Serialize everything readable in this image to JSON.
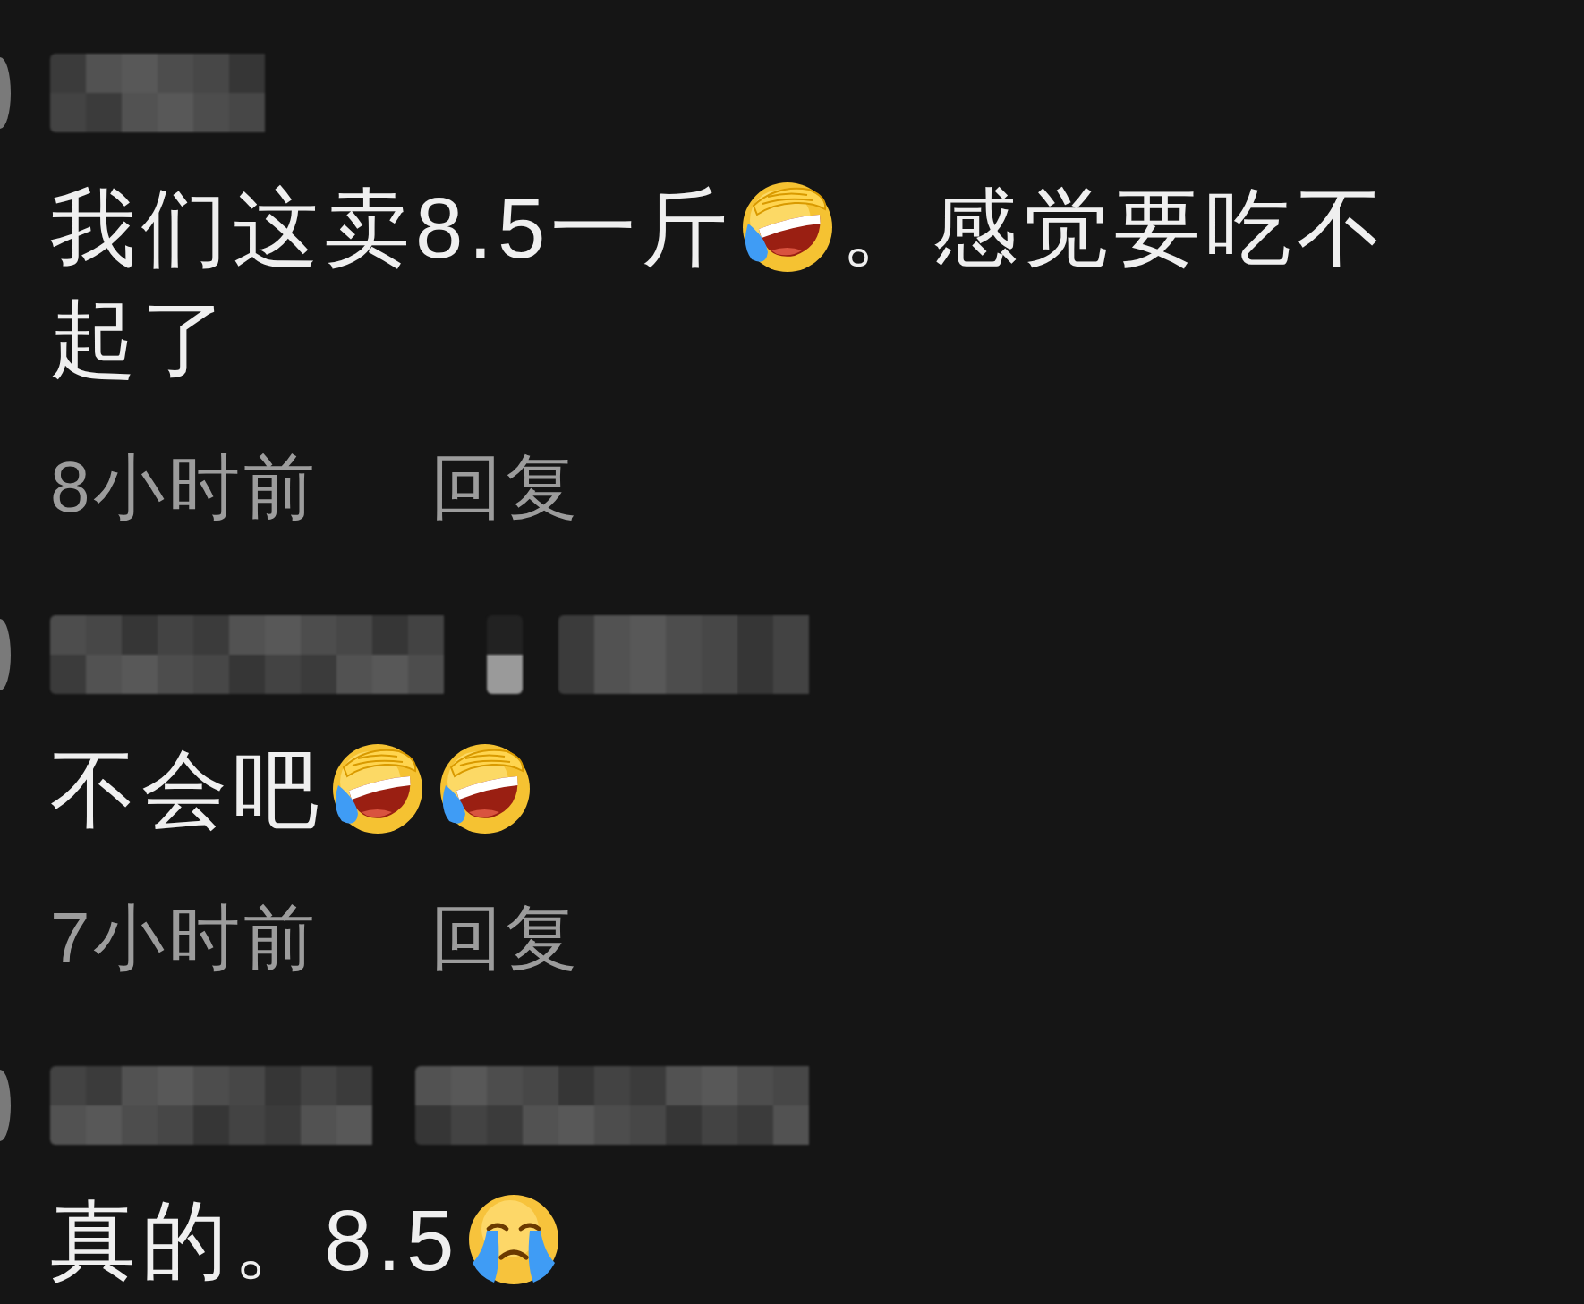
{
  "comments": [
    {
      "author": {
        "pixelated": true
      },
      "lines": [
        [
          {
            "kind": "text",
            "text": "我们这卖8.5一斤"
          },
          {
            "kind": "laugh"
          },
          {
            "kind": "text",
            "text": "。感觉要吃不"
          }
        ],
        [
          {
            "kind": "text",
            "text": "起了"
          }
        ]
      ],
      "time": "8小时前",
      "reply": "回复"
    },
    {
      "author": {
        "pixelated": true
      },
      "lines": [
        [
          {
            "kind": "text",
            "text": "不会吧"
          },
          {
            "kind": "laugh"
          },
          {
            "kind": "laugh"
          }
        ]
      ],
      "time": "7小时前",
      "reply": "回复"
    },
    {
      "author": {
        "pixelated": true
      },
      "lines": [
        [
          {
            "kind": "text",
            "text": "真的。8.5"
          },
          {
            "kind": "cry"
          }
        ]
      ]
    }
  ]
}
